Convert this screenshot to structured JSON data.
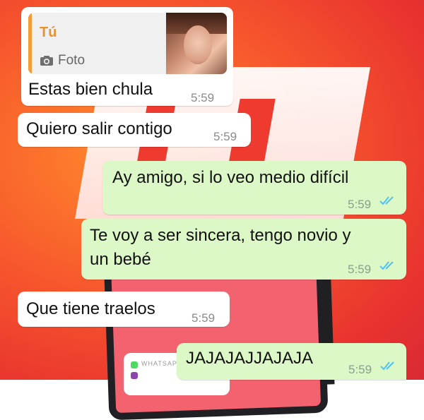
{
  "chat": {
    "reply_quote": {
      "author": "Tú",
      "media_label": "Foto"
    },
    "messages": [
      {
        "text": "Estas bien chula",
        "time": "5:59",
        "direction": "incoming"
      },
      {
        "text": "Quiero salir contigo",
        "time": "5:59",
        "direction": "incoming"
      },
      {
        "text": "Ay amigo, si lo veo medio difícil",
        "time": "5:59",
        "direction": "outgoing",
        "status": "read"
      },
      {
        "text_line1": "Te voy a ser sincera, tengo novio y",
        "text_line2": "un bebé",
        "time": "5:59",
        "direction": "outgoing",
        "status": "read"
      },
      {
        "text": "Que tiene traelos",
        "time": "5:59",
        "direction": "incoming"
      },
      {
        "text": "JAJAJAJJAJAJA",
        "time": "5:59",
        "direction": "outgoing",
        "status": "read"
      }
    ]
  },
  "background": {
    "phone_card_label": "WHATSAPP"
  },
  "colors": {
    "incoming_bubble": "#ffffff",
    "outgoing_bubble": "#dcf8c6",
    "read_ticks": "#4fc3f7",
    "quote_accent": "#f39c3a"
  }
}
